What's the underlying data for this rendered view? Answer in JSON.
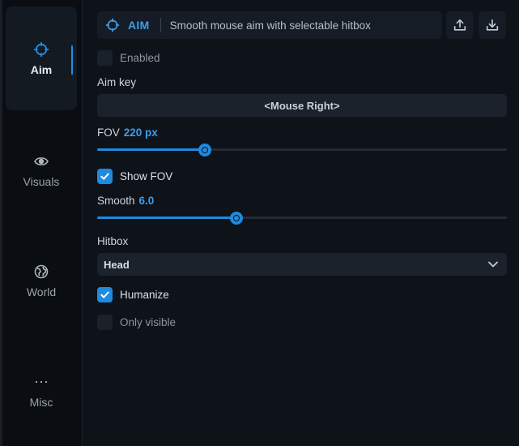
{
  "sidebar": {
    "items": [
      {
        "id": "aim",
        "label": "Aim",
        "icon": "crosshair-icon",
        "active": true
      },
      {
        "id": "visuals",
        "label": "Visuals",
        "icon": "eye-icon",
        "active": false
      },
      {
        "id": "world",
        "label": "World",
        "icon": "globe-icon",
        "active": false
      },
      {
        "id": "misc",
        "label": "Misc",
        "icon": "more-dots-icon",
        "active": false
      }
    ]
  },
  "header": {
    "icon": "crosshair-icon",
    "tag": "AIM",
    "description": "Smooth mouse aim with selectable hitbox",
    "export_icon": "upload-icon",
    "import_icon": "download-icon"
  },
  "settings": {
    "enabled": {
      "label": "Enabled",
      "checked": false
    },
    "aim_key": {
      "label": "Aim key",
      "value": "<Mouse Right>"
    },
    "fov": {
      "label": "FOV",
      "value_text": "220 px",
      "fraction": 0.263
    },
    "show_fov": {
      "label": "Show FOV",
      "checked": true
    },
    "smooth": {
      "label": "Smooth",
      "value_text": "6.0",
      "fraction": 0.34
    },
    "hitbox": {
      "label": "Hitbox",
      "selected": "Head"
    },
    "humanize": {
      "label": "Humanize",
      "checked": true
    },
    "only_visible": {
      "label": "Only visible",
      "checked": false
    }
  },
  "colors": {
    "accent": "#1e8ae0",
    "accent_text": "#3d9ee8",
    "background": "#0e1219",
    "sidebar_bg": "#0a0d12",
    "control_bg": "#1b222c"
  }
}
